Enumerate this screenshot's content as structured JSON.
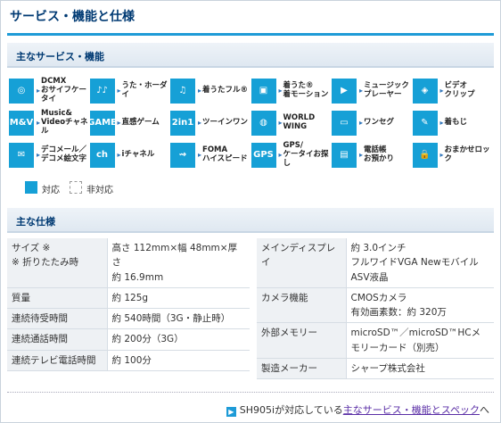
{
  "title": "サービス・機能と仕様",
  "services_heading": "主なサービス・機能",
  "services": [
    {
      "label": "DCMX\nおサイフケータイ",
      "icon": "wallet-icon",
      "glyph": "◎"
    },
    {
      "label": "うた・ホーダイ",
      "icon": "music-note-icon",
      "glyph": "♪♪"
    },
    {
      "label": "着うたフル®",
      "icon": "score-icon",
      "glyph": "♫"
    },
    {
      "label": "着うた®\n着モーション",
      "icon": "film-note-icon",
      "glyph": "▣"
    },
    {
      "label": "ミュージック\nプレーヤー",
      "icon": "play-icon",
      "glyph": "▶"
    },
    {
      "label": "ビデオ\nクリップ",
      "icon": "projector-icon",
      "glyph": "◈"
    },
    {
      "label": "Music&\nVideoチャネル",
      "icon": "music-video-icon",
      "glyph": "M&V"
    },
    {
      "label": "直感ゲーム",
      "icon": "game-icon",
      "glyph": "GAME"
    },
    {
      "label": "ツーインワン",
      "icon": "two-in-one-icon",
      "glyph": "2in1"
    },
    {
      "label": "WORLD\nWING",
      "icon": "globe-icon",
      "glyph": "◍"
    },
    {
      "label": "ワンセグ",
      "icon": "tv-icon",
      "glyph": "▭"
    },
    {
      "label": "着もじ",
      "icon": "tag-icon",
      "glyph": "✎"
    },
    {
      "label": "デコメール／\nデコメ絵文字",
      "icon": "deco-mail-icon",
      "glyph": "✉"
    },
    {
      "label": "iチャネル",
      "icon": "ichannel-icon",
      "glyph": "ch"
    },
    {
      "label": "FOMA\nハイスピード",
      "icon": "speed-icon",
      "glyph": "⇝"
    },
    {
      "label": "GPS/\nケータイお探し",
      "icon": "gps-icon",
      "glyph": "GPS"
    },
    {
      "label": "電話帳\nお預かり",
      "icon": "phonebook-icon",
      "glyph": "▤"
    },
    {
      "label": "おまかせロック",
      "icon": "lock-icon",
      "glyph": "🔒"
    }
  ],
  "legend": {
    "supported": "対応",
    "unsupported": "非対応"
  },
  "specs_heading": "主な仕様",
  "spec_left": [
    {
      "k": "サイズ ※\n※ 折りたたみ時",
      "v": "高さ 112mm×幅 48mm×厚さ\n約 16.9mm"
    },
    {
      "k": "質量",
      "v": "約 125g"
    },
    {
      "k": "連続待受時間",
      "v": "約 540時間（3G・静止時）"
    },
    {
      "k": "連続通話時間",
      "v": "約 200分（3G）"
    },
    {
      "k": "連続テレビ電話時間",
      "v": "約 100分"
    }
  ],
  "spec_right": [
    {
      "k": "メインディスプレイ",
      "v": "約 3.0インチ\nフルワイドVGA Newモバイル\nASV液晶"
    },
    {
      "k": "カメラ機能",
      "v": "CMOSカメラ\n有効画素数：約 320万"
    },
    {
      "k": "外部メモリー",
      "v": "microSD™／microSD™HCメ\nモリーカード（別売）"
    },
    {
      "k": "製造メーカー",
      "v": "シャープ株式会社"
    }
  ],
  "footer": {
    "prefix": "SH905iが対応している",
    "link": "主なサービス・機能とスペック",
    "suffix": "へ"
  },
  "colors": {
    "accent": "#16a0d6",
    "heading": "#003a73",
    "link": "#5a2ea6"
  }
}
